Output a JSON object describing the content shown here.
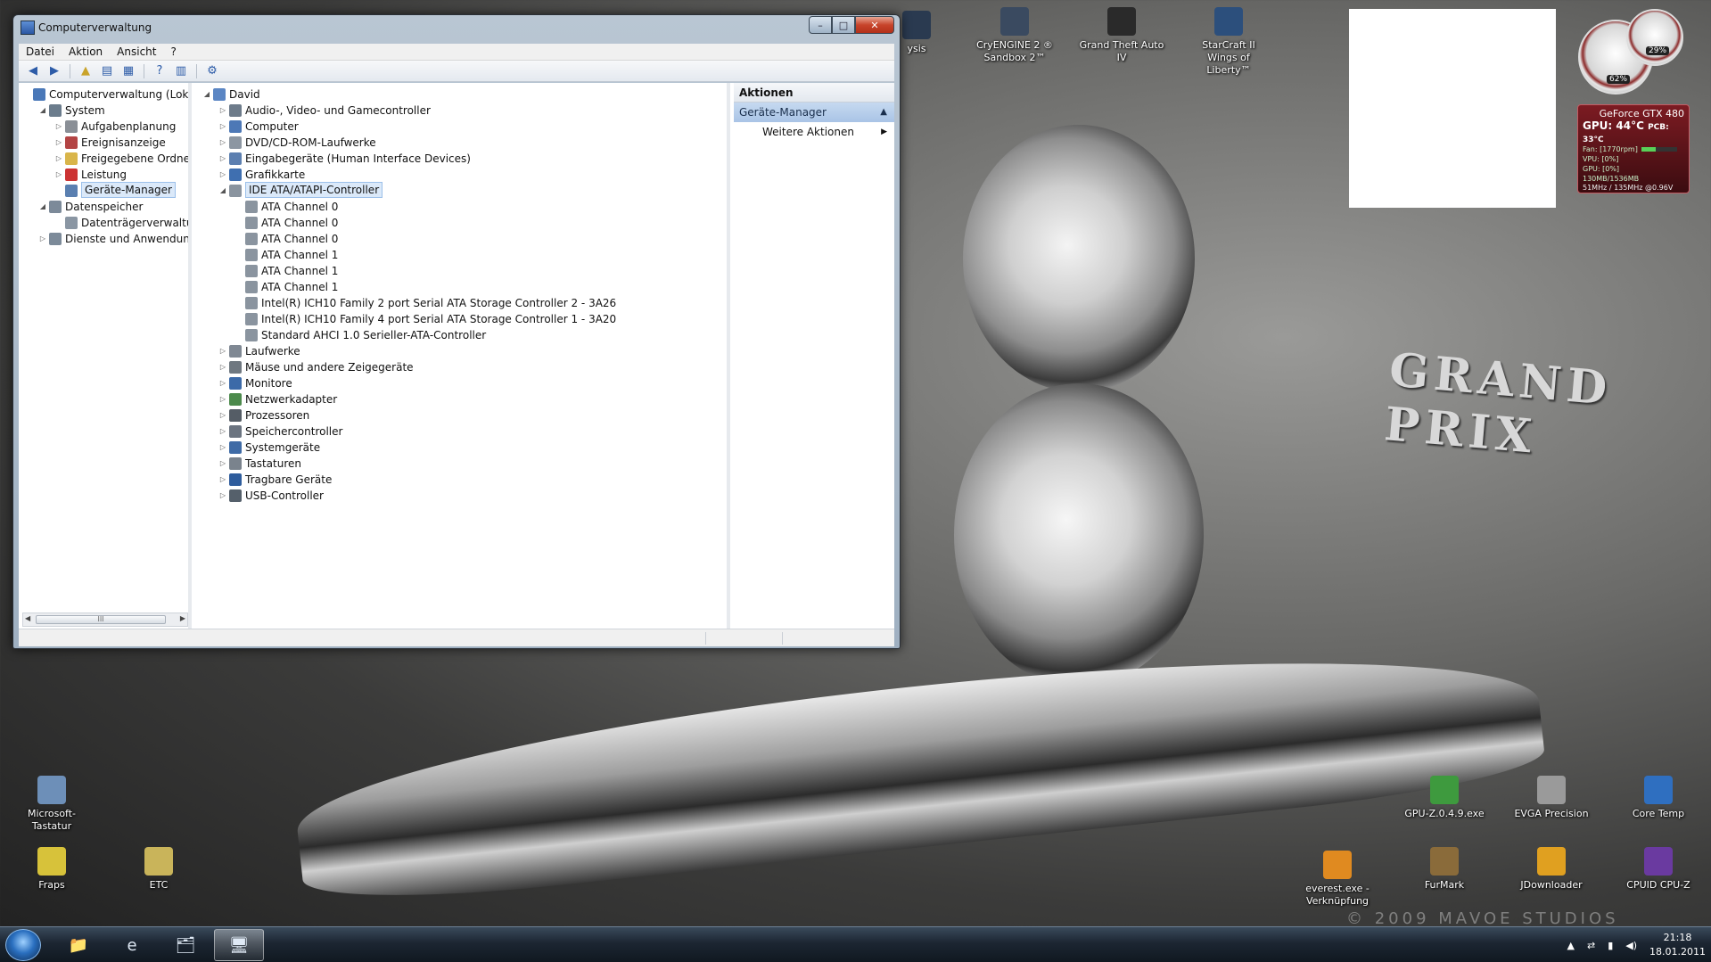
{
  "wallpaper": {
    "brand_text": "GRAND PRIX",
    "copyright": "© 2009 MAVOE STUDIOS"
  },
  "window": {
    "title": "Computerverwaltung",
    "controls": {
      "min": "–",
      "max": "□",
      "close": "✕"
    },
    "menu": [
      "Datei",
      "Aktion",
      "Ansicht",
      "?"
    ],
    "left_tree": [
      {
        "label": "Computerverwaltung (Lokal)",
        "level": 0,
        "expander": "",
        "color": "#4a78b8"
      },
      {
        "label": "System",
        "level": 1,
        "expander": "◢",
        "color": "#6b7c8c"
      },
      {
        "label": "Aufgabenplanung",
        "level": 2,
        "expander": "▷",
        "color": "#8a8f96"
      },
      {
        "label": "Ereignisanzeige",
        "level": 2,
        "expander": "▷",
        "color": "#b34444"
      },
      {
        "label": "Freigegebene Ordner",
        "level": 2,
        "expander": "▷",
        "color": "#d9b54a"
      },
      {
        "label": "Leistung",
        "level": 2,
        "expander": "▷",
        "color": "#cc3333"
      },
      {
        "label": "Geräte-Manager",
        "level": 2,
        "expander": "",
        "color": "#5a7fb0",
        "selected": true
      },
      {
        "label": "Datenspeicher",
        "level": 1,
        "expander": "◢",
        "color": "#7c8a99"
      },
      {
        "label": "Datenträgerverwaltung",
        "level": 2,
        "expander": "",
        "color": "#8a96a3"
      },
      {
        "label": "Dienste und Anwendungen",
        "level": 1,
        "expander": "▷",
        "color": "#7c8a99"
      }
    ],
    "device_tree": [
      {
        "label": "David",
        "level": 0,
        "expander": "◢",
        "color": "#5b86c4"
      },
      {
        "label": "Audio-, Video- und Gamecontroller",
        "level": 1,
        "expander": "▷",
        "color": "#6d7b8a"
      },
      {
        "label": "Computer",
        "level": 1,
        "expander": "▷",
        "color": "#4d78b6"
      },
      {
        "label": "DVD/CD-ROM-Laufwerke",
        "level": 1,
        "expander": "▷",
        "color": "#8c96a2"
      },
      {
        "label": "Eingabegeräte (Human Interface Devices)",
        "level": 1,
        "expander": "▷",
        "color": "#5c7fb0"
      },
      {
        "label": "Grafikkarte",
        "level": 1,
        "expander": "▷",
        "color": "#3f6fb0"
      },
      {
        "label": "IDE ATA/ATAPI-Controller",
        "level": 1,
        "expander": "◢",
        "color": "#8a949f",
        "selected": true
      },
      {
        "label": "ATA Channel 0",
        "level": 2,
        "expander": "",
        "color": "#8a949f"
      },
      {
        "label": "ATA Channel 0",
        "level": 2,
        "expander": "",
        "color": "#8a949f"
      },
      {
        "label": "ATA Channel 0",
        "level": 2,
        "expander": "",
        "color": "#8a949f"
      },
      {
        "label": "ATA Channel 1",
        "level": 2,
        "expander": "",
        "color": "#8a949f"
      },
      {
        "label": "ATA Channel 1",
        "level": 2,
        "expander": "",
        "color": "#8a949f"
      },
      {
        "label": "ATA Channel 1",
        "level": 2,
        "expander": "",
        "color": "#8a949f"
      },
      {
        "label": "Intel(R) ICH10 Family 2 port Serial ATA Storage Controller 2 - 3A26",
        "level": 2,
        "expander": "",
        "color": "#8a949f"
      },
      {
        "label": "Intel(R) ICH10 Family 4 port Serial ATA Storage Controller 1 - 3A20",
        "level": 2,
        "expander": "",
        "color": "#8a949f"
      },
      {
        "label": "Standard AHCI 1.0 Serieller-ATA-Controller",
        "level": 2,
        "expander": "",
        "color": "#8a949f"
      },
      {
        "label": "Laufwerke",
        "level": 1,
        "expander": "▷",
        "color": "#7f8893"
      },
      {
        "label": "Mäuse und andere Zeigegeräte",
        "level": 1,
        "expander": "▷",
        "color": "#6f7880"
      },
      {
        "label": "Monitore",
        "level": 1,
        "expander": "▷",
        "color": "#3c6aa8"
      },
      {
        "label": "Netzwerkadapter",
        "level": 1,
        "expander": "▷",
        "color": "#4c8a4c"
      },
      {
        "label": "Prozessoren",
        "level": 1,
        "expander": "▷",
        "color": "#555d66"
      },
      {
        "label": "Speichercontroller",
        "level": 1,
        "expander": "▷",
        "color": "#6b7480"
      },
      {
        "label": "Systemgeräte",
        "level": 1,
        "expander": "▷",
        "color": "#3f6ba6"
      },
      {
        "label": "Tastaturen",
        "level": 1,
        "expander": "▷",
        "color": "#7a838d"
      },
      {
        "label": "Tragbare Geräte",
        "level": 1,
        "expander": "▷",
        "color": "#2e5c9c"
      },
      {
        "label": "USB-Controller",
        "level": 1,
        "expander": "▷",
        "color": "#55606b"
      }
    ],
    "actions": {
      "header": "Aktionen",
      "section": "Geräte-Manager",
      "more": "Weitere Aktionen"
    },
    "scroll_grip": "III"
  },
  "desktop_icons_top": [
    {
      "label": "ysis",
      "color": "#2a3a50"
    },
    {
      "label": "CryENGINE 2 ® Sandbox 2™",
      "color": "#3a4a60"
    },
    {
      "label": "Grand Theft Auto IV",
      "color": "#2a2a2a"
    },
    {
      "label": "StarCraft II Wings of Liberty™",
      "color": "#2c4f7c"
    }
  ],
  "desktop_icons_left": [
    {
      "label": "Microsoft-Tastatur",
      "color": "#6d8fb8"
    },
    {
      "label": "Fraps",
      "color": "#d7c23a"
    },
    {
      "label": "ETC",
      "color": "#c9b45a"
    }
  ],
  "desktop_icons_right": [
    {
      "label": "GPU-Z.0.4.9.exe",
      "color": "#3e9a3e"
    },
    {
      "label": "EVGA Precision",
      "color": "#9a9a9a"
    },
    {
      "label": "Core Temp",
      "color": "#2f6fc0"
    },
    {
      "label": "everest.exe - Verknüpfung",
      "color": "#e08a20"
    },
    {
      "label": "FurMark",
      "color": "#8a6b3a"
    },
    {
      "label": "JDownloader",
      "color": "#e0a020"
    },
    {
      "label": "CPUID CPU-Z",
      "color": "#6a3aa0"
    }
  ],
  "gadgets": {
    "meter1_value": "62%",
    "meter2_value": "29%",
    "gpu_name": "GeForce GTX 480",
    "gpu_temp": "GPU: 44°C",
    "pcb_temp": "PCB: 33°C",
    "fan": "Fan: [1770rpm]",
    "fan_level": 0.4,
    "vpu": "VPU: [0%]",
    "gpu_load": "GPU: [0%]",
    "memory": "130MB/1536MB",
    "clock": "51MHz / 135MHz @0.96V"
  },
  "taskbar": {
    "apps": [
      {
        "icon": "folder-icon",
        "glyph": "📁",
        "active": false
      },
      {
        "icon": "internet-explorer-icon",
        "glyph": "e",
        "active": false
      },
      {
        "icon": "explorer-folder-icon",
        "glyph": "🗂",
        "active": false
      },
      {
        "icon": "computer-management-icon",
        "glyph": "🖥",
        "active": true
      }
    ],
    "time": "21:18",
    "date": "18.01.2011"
  }
}
